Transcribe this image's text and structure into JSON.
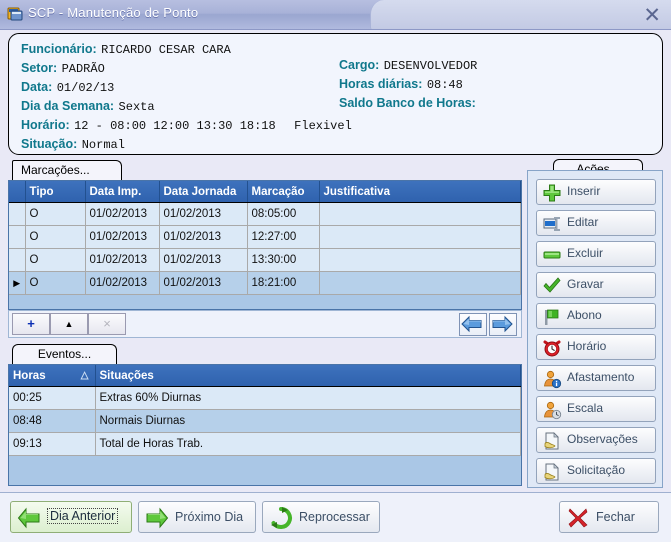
{
  "titlebar": {
    "title": "SCP - Manutenção de Ponto",
    "close_label": "✕",
    "icon": "app-window-icon"
  },
  "header": {
    "funcionario_label": "Funcionário:",
    "funcionario_value": "RICARDO CESAR CARA",
    "setor_label": "Setor:",
    "setor_value": "PADRÃO",
    "data_label": "Data:",
    "data_value": "01/02/13",
    "dia_semana_label": "Dia da Semana:",
    "dia_semana_value": "Sexta",
    "horario_label": "Horário:",
    "horario_value": "12 - 08:00 12:00  13:30 18:18",
    "horario_extra": "Flexivel",
    "situacao_label": "Situação:",
    "situacao_value": "Normal",
    "cargo_label": "Cargo:",
    "cargo_value": "DESENVOLVEDOR",
    "horas_diarias_label": "Horas diárias:",
    "horas_diarias_value": "08:48",
    "saldo_banco_label": "Saldo Banco de Horas:",
    "saldo_banco_value": ""
  },
  "tabs": {
    "marcacoes": "Marcações...",
    "eventos": "Eventos...",
    "acoes": "Ações..."
  },
  "marcacoes_grid": {
    "columns": [
      "Tipo",
      "Data Imp.",
      "Data Jornada",
      "Marcação",
      "Justificativa"
    ],
    "rows": [
      {
        "tipo": "O",
        "data_imp": "01/02/2013",
        "data_jornada": "01/02/2013",
        "marcacao": "08:05:00",
        "justificativa": "",
        "selected": false
      },
      {
        "tipo": "O",
        "data_imp": "01/02/2013",
        "data_jornada": "01/02/2013",
        "marcacao": "12:27:00",
        "justificativa": "",
        "selected": false
      },
      {
        "tipo": "O",
        "data_imp": "01/02/2013",
        "data_jornada": "01/02/2013",
        "marcacao": "13:30:00",
        "justificativa": "",
        "selected": false
      },
      {
        "tipo": "O",
        "data_imp": "01/02/2013",
        "data_jornada": "01/02/2013",
        "marcacao": "18:21:00",
        "justificativa": "",
        "selected": true
      }
    ],
    "row_marker": "▶"
  },
  "navigator": {
    "insert_label": "+",
    "post_label": "▲",
    "delete_label": "×",
    "prev_icon": "arrow-left-icon",
    "next_icon": "arrow-right-icon"
  },
  "eventos_grid": {
    "columns": [
      "Horas",
      "Situações"
    ],
    "sort_indicator": "△",
    "rows": [
      {
        "horas": "00:25",
        "situacoes": "Extras 60% Diurnas",
        "selected": false
      },
      {
        "horas": "08:48",
        "situacoes": "Normais Diurnas",
        "selected": true
      },
      {
        "horas": "09:13",
        "situacoes": "Total de Horas Trab.",
        "selected": false
      }
    ]
  },
  "actions": {
    "buttons": [
      {
        "label": "Inserir",
        "icon": "green-plus-icon"
      },
      {
        "label": "Editar",
        "icon": "edit-window-icon"
      },
      {
        "label": "Excluir",
        "icon": "green-minus-icon"
      },
      {
        "label": "Gravar",
        "icon": "green-check-icon"
      },
      {
        "label": "Abono",
        "icon": "green-flag-icon"
      },
      {
        "label": "Horário",
        "icon": "red-alarm-clock-icon"
      },
      {
        "label": "Afastamento",
        "icon": "user-info-icon"
      },
      {
        "label": "Escala",
        "icon": "user-clock-icon"
      },
      {
        "label": "Observações",
        "icon": "document-note-icon"
      },
      {
        "label": "Solicitação",
        "icon": "document-note-icon"
      }
    ]
  },
  "bottombar": {
    "dia_anterior": "Dia Anterior",
    "proximo_dia": "Próximo Dia",
    "reprocessar": "Reprocessar",
    "fechar": "Fechar"
  },
  "colors": {
    "label_teal": "#10788c",
    "grid_header_blue": "#3365b0",
    "grid_row": "#dbe9f7",
    "grid_row_selected": "#b6d0ea",
    "panel_bg": "#e9e9f6",
    "titlebar_blue": "#a8b2d8"
  }
}
